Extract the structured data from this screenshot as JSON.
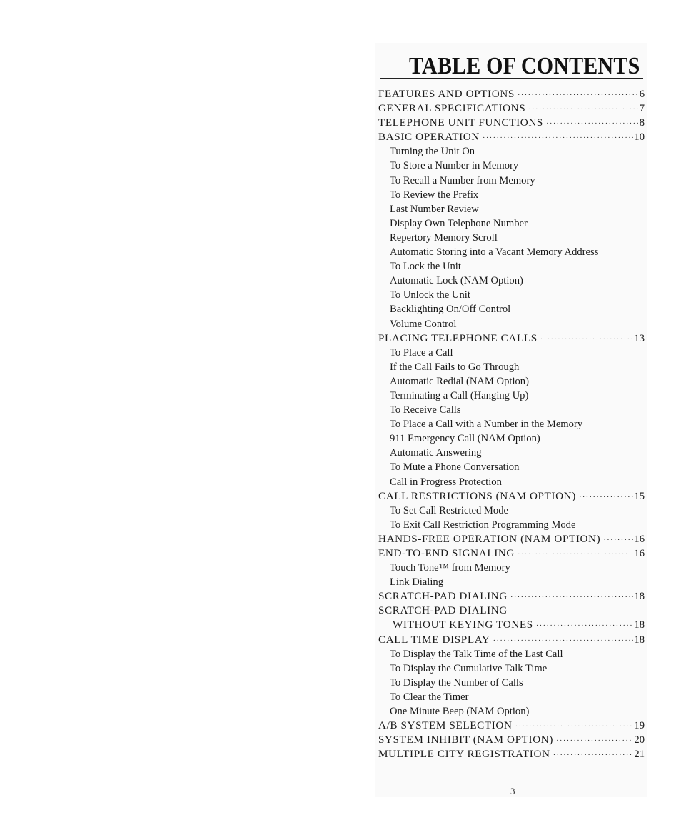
{
  "document": {
    "title": "TABLE OF CONTENTS",
    "page_number": "3",
    "entries": [
      {
        "level": 0,
        "label": "FEATURES AND OPTIONS",
        "page": "6"
      },
      {
        "level": 0,
        "label": "GENERAL SPECIFICATIONS",
        "page": "7"
      },
      {
        "level": 0,
        "label": "TELEPHONE UNIT FUNCTIONS",
        "page": "8"
      },
      {
        "level": 0,
        "label": "BASIC OPERATION",
        "page": "10"
      },
      {
        "level": 1,
        "label": "Turning the Unit On"
      },
      {
        "level": 1,
        "label": "To Store a Number in Memory"
      },
      {
        "level": 1,
        "label": "To Recall a Number from Memory"
      },
      {
        "level": 1,
        "label": "To Review the Prefix"
      },
      {
        "level": 1,
        "label": "Last Number Review"
      },
      {
        "level": 1,
        "label": "Display Own Telephone Number"
      },
      {
        "level": 1,
        "label": "Repertory Memory Scroll"
      },
      {
        "level": 1,
        "label": "Automatic Storing into a Vacant Memory Address"
      },
      {
        "level": 1,
        "label": "To Lock the Unit"
      },
      {
        "level": 1,
        "label": "Automatic Lock (NAM Option)"
      },
      {
        "level": 1,
        "label": "To Unlock the Unit"
      },
      {
        "level": 1,
        "label": "Backlighting On/Off Control"
      },
      {
        "level": 1,
        "label": "Volume Control"
      },
      {
        "level": 0,
        "label": "PLACING TELEPHONE CALLS",
        "page": "13"
      },
      {
        "level": 1,
        "label": "To Place a Call"
      },
      {
        "level": 1,
        "label": "If the Call Fails to Go Through"
      },
      {
        "level": 1,
        "label": "Automatic Redial (NAM Option)"
      },
      {
        "level": 1,
        "label": "Terminating a Call (Hanging Up)"
      },
      {
        "level": 1,
        "label": "To Receive Calls"
      },
      {
        "level": 1,
        "label": "To Place a Call with a Number in the Memory"
      },
      {
        "level": 1,
        "label": "911 Emergency Call (NAM Option)"
      },
      {
        "level": 1,
        "label": "Automatic Answering"
      },
      {
        "level": 1,
        "label": "To Mute a Phone Conversation"
      },
      {
        "level": 1,
        "label": "Call in Progress Protection"
      },
      {
        "level": 0,
        "label": "CALL RESTRICTIONS (NAM OPTION)",
        "page": "15"
      },
      {
        "level": 1,
        "label": "To Set Call Restricted Mode"
      },
      {
        "level": 1,
        "label": "To Exit Call Restriction Programming Mode"
      },
      {
        "level": 0,
        "label": "HANDS-FREE OPERATION (NAM OPTION)",
        "page": "16"
      },
      {
        "level": 0,
        "label": "END-TO-END SIGNALING",
        "page": "16"
      },
      {
        "level": 1,
        "label": "Touch Tone™ from Memory"
      },
      {
        "level": 1,
        "label": "Link Dialing"
      },
      {
        "level": 0,
        "label": "SCRATCH-PAD DIALING",
        "page": "18"
      },
      {
        "level": 0,
        "label": "SCRATCH-PAD DIALING"
      },
      {
        "level": 2,
        "label": "WITHOUT KEYING TONES",
        "page": "18"
      },
      {
        "level": 0,
        "label": "CALL TIME DISPLAY",
        "page": "18"
      },
      {
        "level": 1,
        "label": "To Display the Talk Time of the Last Call"
      },
      {
        "level": 1,
        "label": "To Display the Cumulative Talk Time"
      },
      {
        "level": 1,
        "label": "To Display the Number of Calls"
      },
      {
        "level": 1,
        "label": "To Clear the Timer"
      },
      {
        "level": 1,
        "label": "One Minute Beep (NAM Option)"
      },
      {
        "level": 0,
        "label": "A/B SYSTEM SELECTION",
        "page": "19"
      },
      {
        "level": 0,
        "label": "SYSTEM INHIBIT (NAM OPTION)",
        "page": "20"
      },
      {
        "level": 0,
        "label": "MULTIPLE CITY REGISTRATION",
        "page": "21"
      }
    ]
  }
}
